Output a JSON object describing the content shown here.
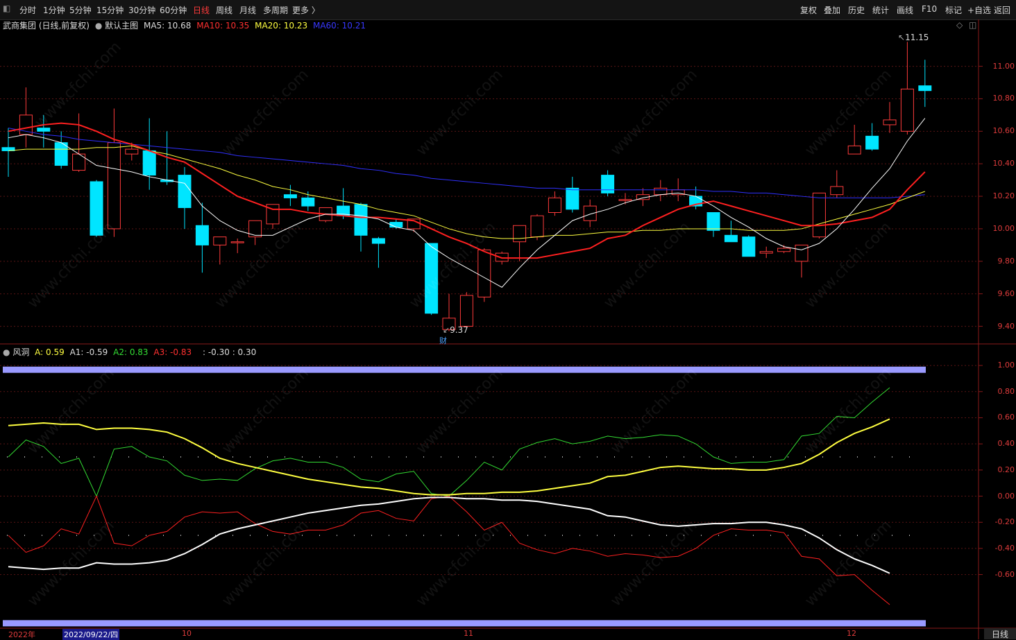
{
  "toolbar": {
    "periods": [
      "分时",
      "1分钟",
      "5分钟",
      "15分钟",
      "30分钟",
      "60分钟",
      "日线",
      "周线",
      "月线",
      "多周期",
      "更多 〉"
    ],
    "active_period": "日线",
    "right_buttons": [
      "复权",
      "叠加",
      "历史",
      "统计",
      "画线",
      "F10",
      "标记",
      "+自选",
      "返回"
    ]
  },
  "main_chart": {
    "title": "武商集团 (日线,前复权)",
    "template": "默认主图",
    "ma5": "MA5: 10.68",
    "ma10": "MA10: 10.35",
    "ma20": "MA20: 10.23",
    "ma60": "MA60: 10.21",
    "high_label": "11.15",
    "low_label": "9.37",
    "marker": "财",
    "y_ticks": [
      "11.00",
      "10.80",
      "10.60",
      "10.40",
      "10.20",
      "10.00",
      "9.80",
      "9.60",
      "9.40"
    ]
  },
  "sub_chart": {
    "name": "风洞",
    "a": "A: 0.59",
    "a1": "A1: -0.59",
    "a2": "A2: 0.83",
    "a3": "A3: -0.83",
    "extra": ": -0.30 : 0.30",
    "y_ticks": [
      "1.00",
      "0.80",
      "0.60",
      "0.40",
      "0.20",
      "0.00",
      "-0.20",
      "-0.40",
      "-0.60"
    ]
  },
  "x_axis": {
    "labels": [
      "2022年",
      "2022/09/22/四",
      "10",
      "11",
      "12"
    ],
    "period_label": "日线"
  },
  "watermark": "www.cfchi.com",
  "colors": {
    "up": "#ff3b3b",
    "down": "#00e5ff",
    "ma5": "#ffffff",
    "ma10": "#ff2020",
    "ma20": "#ffff40",
    "ma60": "#3030ff",
    "band": "#9a9aff"
  },
  "chart_data": {
    "type": "candlestick",
    "candles": [
      {
        "o": 10.5,
        "h": 10.62,
        "l": 10.32,
        "c": 10.48
      },
      {
        "o": 10.58,
        "h": 10.87,
        "l": 10.5,
        "c": 10.7
      },
      {
        "o": 10.62,
        "h": 10.7,
        "l": 10.5,
        "c": 10.6
      },
      {
        "o": 10.53,
        "h": 10.6,
        "l": 10.37,
        "c": 10.39
      },
      {
        "o": 10.36,
        "h": 10.71,
        "l": 10.35,
        "c": 10.46
      },
      {
        "o": 10.29,
        "h": 10.3,
        "l": 9.95,
        "c": 9.96
      },
      {
        "o": 10.0,
        "h": 10.74,
        "l": 9.95,
        "c": 10.53
      },
      {
        "o": 10.46,
        "h": 10.53,
        "l": 10.42,
        "c": 10.49
      },
      {
        "o": 10.48,
        "h": 10.68,
        "l": 10.24,
        "c": 10.33
      },
      {
        "o": 10.3,
        "h": 10.6,
        "l": 10.27,
        "c": 10.29
      },
      {
        "o": 10.33,
        "h": 10.38,
        "l": 10.0,
        "c": 10.13
      },
      {
        "o": 10.02,
        "h": 10.16,
        "l": 9.73,
        "c": 9.9
      },
      {
        "o": 9.9,
        "h": 9.95,
        "l": 9.78,
        "c": 9.95
      },
      {
        "o": 9.92,
        "h": 9.94,
        "l": 9.85,
        "c": 9.92
      },
      {
        "o": 9.95,
        "h": 10.05,
        "l": 9.9,
        "c": 10.05
      },
      {
        "o": 10.03,
        "h": 10.15,
        "l": 10.0,
        "c": 10.15
      },
      {
        "o": 10.21,
        "h": 10.27,
        "l": 10.14,
        "c": 10.19
      },
      {
        "o": 10.19,
        "h": 10.23,
        "l": 10.11,
        "c": 10.14
      },
      {
        "o": 10.05,
        "h": 10.13,
        "l": 10.04,
        "c": 10.13
      },
      {
        "o": 10.14,
        "h": 10.25,
        "l": 10.06,
        "c": 10.08
      },
      {
        "o": 10.15,
        "h": 10.16,
        "l": 9.86,
        "c": 9.96
      },
      {
        "o": 9.94,
        "h": 9.95,
        "l": 9.76,
        "c": 9.91
      },
      {
        "o": 10.04,
        "h": 10.06,
        "l": 10.0,
        "c": 10.01
      },
      {
        "o": 10.0,
        "h": 10.06,
        "l": 9.98,
        "c": 10.06
      },
      {
        "o": 9.91,
        "h": 9.91,
        "l": 9.47,
        "c": 9.48
      },
      {
        "o": 9.38,
        "h": 9.6,
        "l": 9.37,
        "c": 9.45
      },
      {
        "o": 9.4,
        "h": 9.61,
        "l": 9.4,
        "c": 9.59
      },
      {
        "o": 9.58,
        "h": 9.88,
        "l": 9.55,
        "c": 9.87
      },
      {
        "o": 9.8,
        "h": 9.86,
        "l": 9.78,
        "c": 9.85
      },
      {
        "o": 9.92,
        "h": 10.02,
        "l": 9.8,
        "c": 10.02
      },
      {
        "o": 9.95,
        "h": 10.09,
        "l": 9.93,
        "c": 10.08
      },
      {
        "o": 10.1,
        "h": 10.23,
        "l": 10.08,
        "c": 10.19
      },
      {
        "o": 10.25,
        "h": 10.32,
        "l": 10.1,
        "c": 10.12
      },
      {
        "o": 10.05,
        "h": 10.18,
        "l": 10.01,
        "c": 10.14
      },
      {
        "o": 10.33,
        "h": 10.36,
        "l": 10.2,
        "c": 10.22
      },
      {
        "o": 10.18,
        "h": 10.22,
        "l": 10.15,
        "c": 10.18
      },
      {
        "o": 10.18,
        "h": 10.25,
        "l": 10.14,
        "c": 10.21
      },
      {
        "o": 10.21,
        "h": 10.3,
        "l": 10.17,
        "c": 10.25
      },
      {
        "o": 10.21,
        "h": 10.31,
        "l": 10.17,
        "c": 10.24
      },
      {
        "o": 10.2,
        "h": 10.26,
        "l": 10.12,
        "c": 10.14
      },
      {
        "o": 10.1,
        "h": 10.1,
        "l": 9.95,
        "c": 9.99
      },
      {
        "o": 9.96,
        "h": 10.05,
        "l": 9.92,
        "c": 9.92
      },
      {
        "o": 9.95,
        "h": 9.96,
        "l": 9.83,
        "c": 9.83
      },
      {
        "o": 9.85,
        "h": 9.89,
        "l": 9.82,
        "c": 9.86
      },
      {
        "o": 9.86,
        "h": 9.9,
        "l": 9.85,
        "c": 9.88
      },
      {
        "o": 9.8,
        "h": 9.9,
        "l": 9.7,
        "c": 9.9
      },
      {
        "o": 9.95,
        "h": 10.22,
        "l": 9.94,
        "c": 10.22
      },
      {
        "o": 10.21,
        "h": 10.36,
        "l": 10.19,
        "c": 10.26
      },
      {
        "o": 10.46,
        "h": 10.64,
        "l": 10.46,
        "c": 10.51
      },
      {
        "o": 10.57,
        "h": 10.65,
        "l": 10.48,
        "c": 10.49
      },
      {
        "o": 10.64,
        "h": 10.78,
        "l": 10.59,
        "c": 10.67
      },
      {
        "o": 10.6,
        "h": 11.15,
        "l": 10.58,
        "c": 10.86
      },
      {
        "o": 10.88,
        "h": 11.04,
        "l": 10.75,
        "c": 10.85
      }
    ],
    "ma": {
      "MA5": [
        10.56,
        10.58,
        10.56,
        10.53,
        10.46,
        10.39,
        10.37,
        10.35,
        10.32,
        10.3,
        10.28,
        10.14,
        10.05,
        9.99,
        9.96,
        9.96,
        10.01,
        10.06,
        10.09,
        10.09,
        10.08,
        10.06,
        10.01,
        9.99,
        9.89,
        9.82,
        9.76,
        9.7,
        9.64,
        9.76,
        9.87,
        9.96,
        10.05,
        10.09,
        10.12,
        10.16,
        10.19,
        10.21,
        10.22,
        10.2,
        10.14,
        10.07,
        10.01,
        9.94,
        9.89,
        9.87,
        9.91,
        10.0,
        10.12,
        10.25,
        10.37,
        10.54,
        10.68
      ],
      "MA10": [
        10.6,
        10.62,
        10.64,
        10.65,
        10.64,
        10.6,
        10.55,
        10.52,
        10.48,
        10.44,
        10.41,
        10.34,
        10.27,
        10.2,
        10.16,
        10.12,
        10.12,
        10.1,
        10.09,
        10.08,
        10.07,
        10.07,
        10.06,
        10.05,
        10.0,
        9.95,
        9.91,
        9.86,
        9.82,
        9.82,
        9.82,
        9.84,
        9.86,
        9.88,
        9.94,
        9.96,
        10.02,
        10.07,
        10.12,
        10.15,
        10.17,
        10.14,
        10.11,
        10.08,
        10.05,
        10.02,
        10.02,
        10.03,
        10.05,
        10.07,
        10.12,
        10.24,
        10.35
      ],
      "MA20": [
        10.48,
        10.49,
        10.49,
        10.49,
        10.49,
        10.5,
        10.5,
        10.51,
        10.48,
        10.46,
        10.43,
        10.4,
        10.37,
        10.33,
        10.3,
        10.26,
        10.24,
        10.21,
        10.19,
        10.17,
        10.15,
        10.12,
        10.1,
        10.08,
        10.04,
        10.0,
        9.97,
        9.95,
        9.94,
        9.94,
        9.95,
        9.96,
        9.96,
        9.97,
        9.98,
        9.98,
        9.99,
        9.99,
        10.0,
        10.0,
        10.0,
        10.0,
        9.99,
        9.99,
        9.99,
        10.0,
        10.03,
        10.06,
        10.09,
        10.12,
        10.15,
        10.19,
        10.23
      ],
      "MA60": [
        10.62,
        10.6,
        10.58,
        10.57,
        10.55,
        10.54,
        10.53,
        10.52,
        10.51,
        10.5,
        10.49,
        10.48,
        10.47,
        10.45,
        10.44,
        10.43,
        10.42,
        10.41,
        10.4,
        10.39,
        10.37,
        10.36,
        10.34,
        10.33,
        10.31,
        10.3,
        10.29,
        10.28,
        10.27,
        10.26,
        10.25,
        10.25,
        10.24,
        10.24,
        10.24,
        10.24,
        10.24,
        10.24,
        10.24,
        10.24,
        10.23,
        10.23,
        10.22,
        10.22,
        10.21,
        10.2,
        10.19,
        10.19,
        10.19,
        10.19,
        10.19,
        10.2,
        10.21
      ]
    },
    "indicator": {
      "A": [
        0.54,
        0.55,
        0.56,
        0.55,
        0.55,
        0.51,
        0.52,
        0.52,
        0.51,
        0.49,
        0.44,
        0.37,
        0.29,
        0.25,
        0.22,
        0.19,
        0.16,
        0.13,
        0.11,
        0.09,
        0.07,
        0.06,
        0.04,
        0.02,
        0.01,
        0.01,
        0.02,
        0.02,
        0.03,
        0.03,
        0.04,
        0.06,
        0.08,
        0.1,
        0.15,
        0.16,
        0.19,
        0.22,
        0.23,
        0.22,
        0.21,
        0.21,
        0.2,
        0.2,
        0.22,
        0.25,
        0.32,
        0.41,
        0.48,
        0.53,
        0.59
      ],
      "A1": [
        -0.54,
        -0.55,
        -0.56,
        -0.55,
        -0.55,
        -0.51,
        -0.52,
        -0.52,
        -0.51,
        -0.49,
        -0.44,
        -0.37,
        -0.29,
        -0.25,
        -0.22,
        -0.19,
        -0.16,
        -0.13,
        -0.11,
        -0.09,
        -0.07,
        -0.06,
        -0.04,
        -0.02,
        -0.01,
        -0.01,
        -0.02,
        -0.02,
        -0.03,
        -0.03,
        -0.04,
        -0.06,
        -0.08,
        -0.1,
        -0.15,
        -0.16,
        -0.19,
        -0.22,
        -0.23,
        -0.22,
        -0.21,
        -0.21,
        -0.2,
        -0.2,
        -0.22,
        -0.25,
        -0.32,
        -0.41,
        -0.48,
        -0.53,
        -0.59
      ],
      "A2": [
        0.3,
        0.43,
        0.38,
        0.25,
        0.29,
        0.0,
        0.36,
        0.38,
        0.3,
        0.27,
        0.16,
        0.12,
        0.13,
        0.12,
        0.21,
        0.27,
        0.29,
        0.26,
        0.26,
        0.22,
        0.13,
        0.11,
        0.17,
        0.19,
        0.02,
        0.0,
        0.12,
        0.26,
        0.2,
        0.36,
        0.41,
        0.44,
        0.4,
        0.42,
        0.46,
        0.44,
        0.45,
        0.47,
        0.46,
        0.4,
        0.3,
        0.25,
        0.26,
        0.26,
        0.28,
        0.46,
        0.48,
        0.61,
        0.6,
        0.72,
        0.83
      ],
      "A3": [
        -0.3,
        -0.43,
        -0.38,
        -0.25,
        -0.29,
        0.0,
        -0.36,
        -0.38,
        -0.3,
        -0.27,
        -0.16,
        -0.12,
        -0.13,
        -0.12,
        -0.21,
        -0.27,
        -0.29,
        -0.26,
        -0.26,
        -0.22,
        -0.13,
        -0.11,
        -0.17,
        -0.19,
        -0.02,
        0.0,
        -0.12,
        -0.26,
        -0.2,
        -0.36,
        -0.41,
        -0.44,
        -0.4,
        -0.42,
        -0.46,
        -0.44,
        -0.45,
        -0.47,
        -0.46,
        -0.4,
        -0.3,
        -0.25,
        -0.26,
        -0.26,
        -0.28,
        -0.46,
        -0.48,
        -0.61,
        -0.6,
        -0.72,
        -0.83
      ],
      "ref_levels": [
        0.3,
        -0.3
      ],
      "band_levels": [
        0.97,
        -0.97
      ]
    },
    "ylim_main": [
      9.3,
      11.22
    ],
    "ylim_sub": [
      -1.0,
      1.08
    ]
  }
}
